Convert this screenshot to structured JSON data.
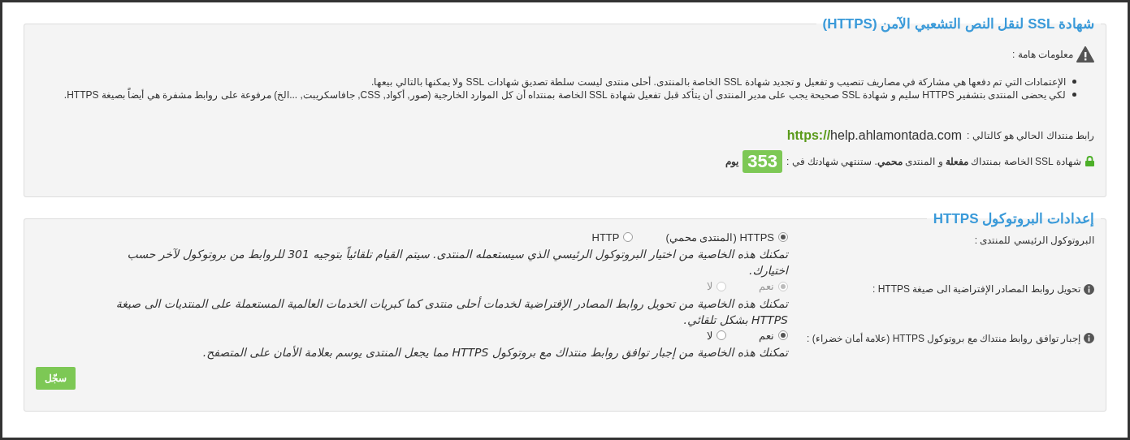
{
  "ssl_panel": {
    "title": "شهادة SSL لنقل النص التشعبي الآمن (HTTPS)",
    "notice_label": "معلومات هامة :",
    "notes": [
      "الإعتمادات التي تم دفعها هي مشاركة في مصاريف تنصيب و تفعيل و تجديد شهادة SSL الخاصة بالمنتدى. أحلى منتدى ليست سلطة تصديق شهادات SSL ولا يمكنها بالتالي بيعها.",
      "لكي يحضى المنتدى بتشفير HTTPS سليم و شهادة SSL صحيحة يجب على مدير المنتدى أن يتأكد قبل تفعيل شهادة SSL الخاصة بمنتداه أن كل الموارد الخارجية (صور, أكواد, CSS, جافاسكريبت, ...الخ) مرفوعة على روابط مشفرة هي أيضاً بصيغة HTTPS."
    ],
    "url_label": "رابط منتداك الحالي هو كالتالي :",
    "url_scheme": "https://",
    "url_host": "help.ahlamontada.com",
    "status_text": "شهادة SSL الخاصة بمنتداك **مفعلة** و المنتدى **محمي**. ستنتهي شهادتك في :",
    "days": "353",
    "days_unit": "يوم"
  },
  "protocol_panel": {
    "title": "إعدادات البروتوكول HTTPS",
    "settings": [
      {
        "label": "البروتوكول الرئيسي للمنتدى :",
        "has_info": false,
        "disabled": false,
        "options": [
          {
            "label": "HTTPS (المنتدى محمي)",
            "selected": true
          },
          {
            "label": "HTTP",
            "selected": false
          }
        ],
        "description": "تمكنك هذه الخاصية من اختيار البروتوكول الرئيسي الذي سيستعمله المنتدى. سيتم القيام تلقائياً بتوجيه 301 للروابط من بروتوكول لآخر حسب اختيارك."
      },
      {
        "label": "تحويل روابط المصادر الإفتراضية الى صيغة HTTPS :",
        "has_info": true,
        "disabled": true,
        "options": [
          {
            "label": "نعم",
            "selected": true
          },
          {
            "label": "لا",
            "selected": false
          }
        ],
        "description": "تمكنك هذه الخاصية من تحويل روابط المصادر الإفتراضية لخدمات أحلى منتدى كما كبريات الخدمات العالمية المستعملة على المنتديات الى صيغة HTTPS بشكل تلقائي."
      },
      {
        "label": "إجبار توافق روابط منتداك مع بروتوكول HTTPS (علامة أمان خضراء) :",
        "has_info": true,
        "disabled": false,
        "options": [
          {
            "label": "نعم",
            "selected": true
          },
          {
            "label": "لا",
            "selected": false
          }
        ],
        "description": "تمكنك هذه الخاصية من إجبار توافق روابط منتداك مع بروتوكول HTTPS مما يجعل المنتدى يوسم بعلامة الأمان على المتصفح."
      }
    ],
    "save_button": "سجّل"
  }
}
